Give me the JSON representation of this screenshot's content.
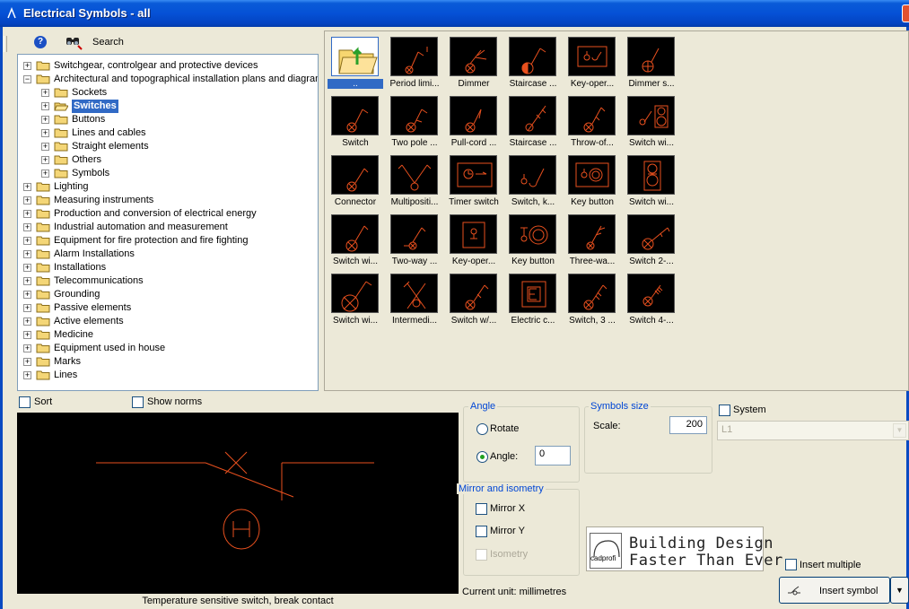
{
  "window": {
    "title": "Electrical Symbols - all"
  },
  "toolbar": {
    "search_label": "Search"
  },
  "tree": {
    "items": [
      {
        "label": "Switchgear, controlgear and protective devices",
        "level": 0,
        "expanded": false,
        "selected": false
      },
      {
        "label": "Architectural and topographical installation plans and diagrams",
        "level": 0,
        "expanded": true,
        "selected": false
      },
      {
        "label": "Sockets",
        "level": 1,
        "expanded": false,
        "selected": false
      },
      {
        "label": "Switches",
        "level": 1,
        "expanded": false,
        "selected": true
      },
      {
        "label": "Buttons",
        "level": 1,
        "expanded": false,
        "selected": false
      },
      {
        "label": "Lines and cables",
        "level": 1,
        "expanded": false,
        "selected": false
      },
      {
        "label": "Straight elements",
        "level": 1,
        "expanded": false,
        "selected": false
      },
      {
        "label": "Others",
        "level": 1,
        "expanded": false,
        "selected": false
      },
      {
        "label": "Symbols",
        "level": 1,
        "expanded": false,
        "selected": false
      },
      {
        "label": "Lighting",
        "level": 0,
        "expanded": false,
        "selected": false
      },
      {
        "label": "Measuring instruments",
        "level": 0,
        "expanded": false,
        "selected": false
      },
      {
        "label": "Production and conversion of electrical energy",
        "level": 0,
        "expanded": false,
        "selected": false
      },
      {
        "label": "Industrial automation and measurement",
        "level": 0,
        "expanded": false,
        "selected": false
      },
      {
        "label": "Equipment for fire protection and fire fighting",
        "level": 0,
        "expanded": false,
        "selected": false
      },
      {
        "label": "Alarm Installations",
        "level": 0,
        "expanded": false,
        "selected": false
      },
      {
        "label": "Installations",
        "level": 0,
        "expanded": false,
        "selected": false
      },
      {
        "label": "Telecommunications",
        "level": 0,
        "expanded": false,
        "selected": false
      },
      {
        "label": "Grounding",
        "level": 0,
        "expanded": false,
        "selected": false
      },
      {
        "label": "Passive elements",
        "level": 0,
        "expanded": false,
        "selected": false
      },
      {
        "label": "Active elements",
        "level": 0,
        "expanded": false,
        "selected": false
      },
      {
        "label": "Medicine",
        "level": 0,
        "expanded": false,
        "selected": false
      },
      {
        "label": "Equipment used in house",
        "level": 0,
        "expanded": false,
        "selected": false
      },
      {
        "label": "Marks",
        "level": 0,
        "expanded": false,
        "selected": false
      },
      {
        "label": "Lines",
        "level": 0,
        "expanded": false,
        "selected": false
      }
    ]
  },
  "gallery": {
    "tiles": [
      {
        "caption": "..",
        "kind": "folder-up"
      },
      {
        "caption": "Period limi...",
        "kind": "switch-period"
      },
      {
        "caption": "Dimmer",
        "kind": "dimmer"
      },
      {
        "caption": "Staircase ...",
        "kind": "staircase-half"
      },
      {
        "caption": "Key-oper...",
        "kind": "key-box"
      },
      {
        "caption": "Dimmer s...",
        "kind": "dimmer-switch"
      },
      {
        "caption": "Switch",
        "kind": "switch"
      },
      {
        "caption": "Two pole ...",
        "kind": "two-pole"
      },
      {
        "caption": "Pull-cord ...",
        "kind": "pull-cord"
      },
      {
        "caption": "Staircase ...",
        "kind": "staircase"
      },
      {
        "caption": "Throw-of...",
        "kind": "throw-off"
      },
      {
        "caption": "Switch wi...",
        "kind": "switch-speaker"
      },
      {
        "caption": "Connector",
        "kind": "connector"
      },
      {
        "caption": "Multipositi...",
        "kind": "multiposition"
      },
      {
        "caption": "Timer switch",
        "kind": "timer"
      },
      {
        "caption": "Switch, k...",
        "kind": "switch-key"
      },
      {
        "caption": "Key button",
        "kind": "key-button-box"
      },
      {
        "caption": "Switch wi...",
        "kind": "switch-double-ring"
      },
      {
        "caption": "Switch wi...",
        "kind": "switch-cross"
      },
      {
        "caption": "Two-way ...",
        "kind": "two-way"
      },
      {
        "caption": "Key-oper...",
        "kind": "key-operated-box"
      },
      {
        "caption": "Key button",
        "kind": "key-button-ring"
      },
      {
        "caption": "Three-wa...",
        "kind": "three-way"
      },
      {
        "caption": "Switch 2-...",
        "kind": "switch-2"
      },
      {
        "caption": "Switch wi...",
        "kind": "switch-big-cross"
      },
      {
        "caption": "Intermedi...",
        "kind": "intermediate"
      },
      {
        "caption": "Switch w/...",
        "kind": "switch-w"
      },
      {
        "caption": "Electric c...",
        "kind": "electric-c"
      },
      {
        "caption": "Switch, 3 ...",
        "kind": "switch-3"
      },
      {
        "caption": "Switch 4-...",
        "kind": "switch-4"
      }
    ]
  },
  "options": {
    "sort_label": "Sort",
    "show_norms_label": "Show norms",
    "sort_checked": false,
    "show_norms_checked": false
  },
  "preview": {
    "caption": "Temperature sensitive switch, break contact"
  },
  "angle": {
    "group_title": "Angle",
    "rotate_label": "Rotate",
    "angle_label": "Angle:",
    "angle_value": "0",
    "selected": "angle"
  },
  "symbols_size": {
    "group_title": "Symbols size",
    "scale_label": "Scale:",
    "scale_value": "200"
  },
  "system": {
    "label": "System",
    "checked": false,
    "layer_value": "L1"
  },
  "mirror": {
    "group_title": "Mirror and isometry",
    "mirror_x_label": "Mirror X",
    "mirror_y_label": "Mirror Y",
    "isometry_label": "Isometry"
  },
  "status": {
    "current_unit": "Current unit: millimetres"
  },
  "banner": {
    "logo_text": "cadprofi",
    "line1": "Building Design",
    "line2": "Faster Than Ever"
  },
  "insert": {
    "multiple_label": "Insert multiple",
    "multiple_checked": false,
    "button_label": "Insert symbol"
  },
  "colors": {
    "symbol_stroke": "#e8501e",
    "selection": "#316ac5",
    "titlebar": "#0551d6"
  }
}
